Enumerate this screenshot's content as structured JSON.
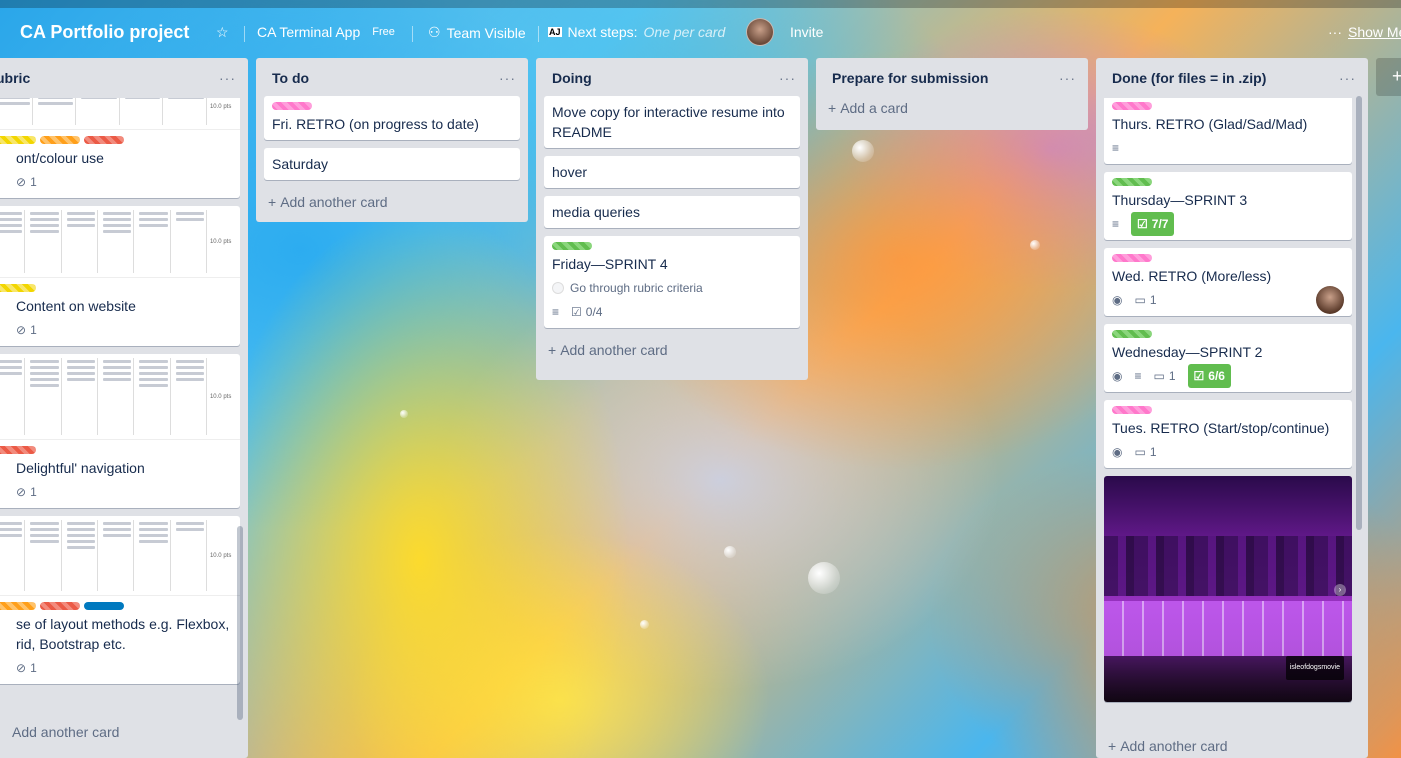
{
  "header": {
    "board_title": "CA Portfolio project",
    "team_board": "CA Terminal App",
    "team_plan": "Free",
    "visibility": "Team Visible",
    "next_steps_label": "Next steps:",
    "next_steps_value": "One per card",
    "invite": "Invite",
    "show_menu": "Show Me"
  },
  "lists": {
    "rubric": {
      "title": "ubric",
      "cards": [
        {
          "title": "ont/colour use",
          "attachments": "1"
        },
        {
          "title": "Content on website",
          "attachments": "1"
        },
        {
          "title": "Delightful' navigation",
          "attachments": "1"
        },
        {
          "title": "se of layout methods e.g. Flexbox, rid, Bootstrap etc.",
          "line1": "se of layout methods e.g. Flexbox,",
          "line2": "rid, Bootstrap etc.",
          "attachments": "1"
        }
      ],
      "add": "Add another card"
    },
    "todo": {
      "title": "To do",
      "cards": [
        {
          "title": "Fri. RETRO (on progress to date)"
        },
        {
          "title": "Saturday"
        }
      ],
      "add": "Add another card"
    },
    "doing": {
      "title": "Doing",
      "cards": [
        {
          "title": "Move copy for interactive resume into README"
        },
        {
          "title": "hover"
        },
        {
          "title": "media queries"
        },
        {
          "title": "Friday—SPRINT 4",
          "checklist_item": "Go through rubric criteria",
          "checklist": "0/4"
        }
      ],
      "add": "Add another card"
    },
    "prepare": {
      "title": "Prepare for submission",
      "add": "Add a card"
    },
    "done": {
      "title": "Done (for files = in .zip)",
      "cards": [
        {
          "title": "Thurs. RETRO (Glad/Sad/Mad)"
        },
        {
          "title": "Thursday—SPRINT 3",
          "checklist": "7/7"
        },
        {
          "title": "Wed. RETRO (More/less)",
          "comments": "1"
        },
        {
          "title": "Wednesday—SPRINT 2",
          "comments": "1",
          "checklist": "6/6"
        },
        {
          "title": "Tues. RETRO (Start/stop/continue)",
          "comments": "1"
        }
      ],
      "image_caption": "isleofdogsmovie",
      "add": "Add another card"
    }
  },
  "rubric_points": "10.0 pts",
  "colors": {
    "pink": "#ff78cb",
    "green": "#61bd4f",
    "yellow": "#f2d600",
    "orange": "#ff9f1a",
    "red": "#eb5a46",
    "blue": "#0079bf"
  }
}
